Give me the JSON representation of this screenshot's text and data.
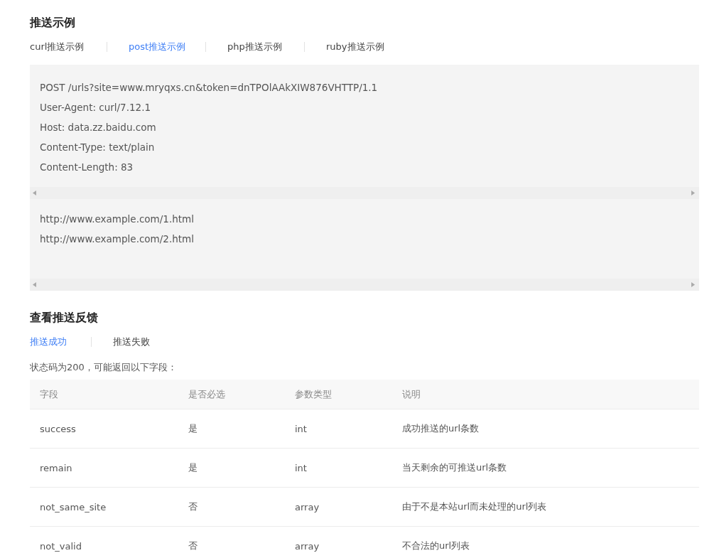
{
  "examples": {
    "title": "推送示例",
    "tabs": [
      {
        "label": "curl推送示例",
        "selected": false
      },
      {
        "label": "post推送示例",
        "selected": true
      },
      {
        "label": "php推送示例",
        "selected": false
      },
      {
        "label": "ruby推送示例",
        "selected": false
      }
    ],
    "code_blocks": [
      {
        "lines": [
          "POST /urls?site=www.mryqxs.cn&token=dnTPOlAAkXIW876VHTTP/1.1",
          "User-Agent: curl/7.12.1",
          "Host: data.zz.baidu.com",
          "Content-Type: text/plain",
          "Content-Length: 83"
        ]
      },
      {
        "lines": [
          "http://www.example.com/1.html",
          "http://www.example.com/2.html"
        ]
      }
    ]
  },
  "feedback": {
    "title": "查看推送反馈",
    "tabs": [
      {
        "label": "推送成功",
        "selected": true
      },
      {
        "label": "推送失败",
        "selected": false
      }
    ],
    "note": "状态码为200，可能返回以下字段：",
    "table": {
      "columns": [
        "字段",
        "是否必选",
        "参数类型",
        "说明"
      ],
      "rows": [
        [
          "success",
          "是",
          "int",
          "成功推送的url条数"
        ],
        [
          "remain",
          "是",
          "int",
          "当天剩余的可推送url条数"
        ],
        [
          "not_same_site",
          "否",
          "array",
          "由于不是本站url而未处理的url列表"
        ],
        [
          "not_valid",
          "否",
          "array",
          "不合法的url列表"
        ]
      ]
    }
  }
}
